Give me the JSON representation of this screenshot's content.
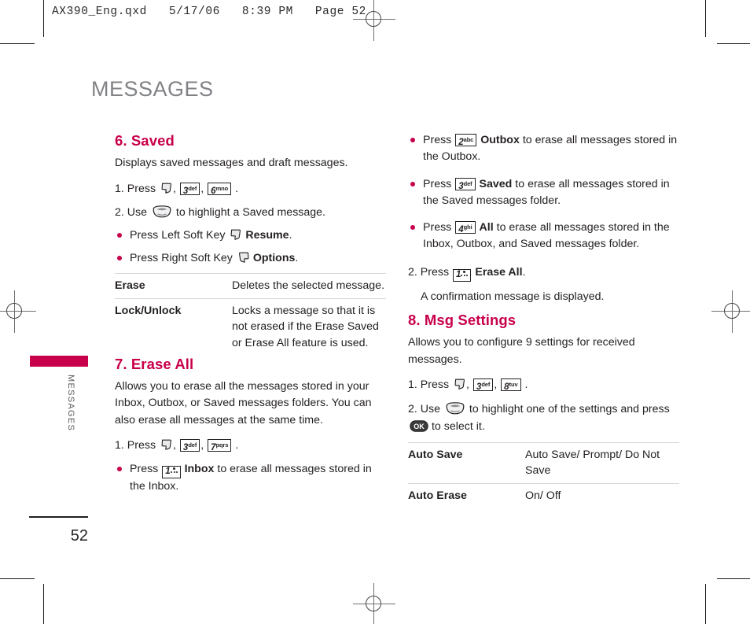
{
  "print_marks": {
    "slug": "AX390_Eng.qxd   5/17/06   8:39 PM   Page 52"
  },
  "side": {
    "tab_label": "MESSAGES",
    "page_number": "52"
  },
  "chapter": {
    "title": "MESSAGES"
  },
  "colors": {
    "accent": "#c8004b",
    "chapter_title": "#808285",
    "body_text": "#231f20",
    "rule": "#d7d8da"
  },
  "icons": {
    "left_soft_key": "left-soft-key-icon",
    "right_soft_key": "right-soft-key-icon",
    "nav_key": "navigation-key-icon",
    "ok_key": "ok-key-icon",
    "key_1": "key-1-voicemail",
    "key_2": "key-2-abc",
    "key_3": "key-3-def",
    "key_4": "key-4-ghi",
    "key_6": "key-6-mno",
    "key_7": "key-7-pqrs",
    "key_8": "key-8-tuv",
    "ok_label": "OK"
  },
  "keycaps": {
    "k1": {
      "digit": "1",
      "letters": ""
    },
    "k2": {
      "digit": "2",
      "letters": "abc"
    },
    "k3": {
      "digit": "3",
      "letters": "def"
    },
    "k4": {
      "digit": "4",
      "letters": "ghi"
    },
    "k6": {
      "digit": "6",
      "letters": "mno"
    },
    "k7": {
      "digit": "7",
      "letters": "pqrs"
    },
    "k8": {
      "digit": "8",
      "letters": "tuv"
    }
  },
  "left_column": {
    "section_saved": {
      "heading": "6. Saved",
      "intro": "Displays saved messages and draft messages.",
      "step1_prefix": "1. Press",
      "step1_sep": ",",
      "step1_end": ".",
      "step2_prefix": "2. Use",
      "step2_suffix": "to highlight a Saved message.",
      "bullets": [
        {
          "pre": "Press Left Soft Key",
          "bold": "Resume",
          "post": "."
        },
        {
          "pre": "Press Right Soft Key",
          "bold": "Options",
          "post": "."
        }
      ],
      "table": [
        {
          "term": "Erase",
          "desc": "Deletes the selected message."
        },
        {
          "term": "Lock/Unlock",
          "desc": "Locks a message so that it is not erased if the Erase Saved or Erase All feature is used."
        }
      ]
    },
    "section_erase_all": {
      "heading": "7. Erase All",
      "intro": "Allows you to erase all the messages stored in your Inbox, Outbox, or Saved messages folders. You can also erase all messages at the same time.",
      "step1_prefix": "1. Press",
      "step1_sep": ",",
      "step1_end": ".",
      "bullets": [
        {
          "pre": "Press",
          "bold": "Inbox",
          "post": "to erase all messages stored in the Inbox."
        }
      ]
    }
  },
  "right_column": {
    "erase_all_continued": {
      "bullets": [
        {
          "pre": "Press",
          "bold": "Outbox",
          "post": "to erase all messages stored in the Outbox."
        },
        {
          "pre": "Press",
          "bold": "Saved",
          "post": "to erase all messages stored in the Saved messages folder."
        },
        {
          "pre": "Press",
          "bold": "All",
          "post": "to erase all messages stored in the Inbox, Outbox, and Saved messages folder."
        }
      ],
      "step2_prefix": "2. Press",
      "step2_bold": "Erase All",
      "step2_end": ".",
      "note": "A confirmation message is displayed."
    },
    "section_msg_settings": {
      "heading": "8. Msg Settings",
      "intro": "Allows you to configure 9 settings for received messages.",
      "step1_prefix": "1. Press",
      "step1_sep": ",",
      "step1_end": ".",
      "step2_prefix": "2. Use",
      "step2_mid": "to highlight one of the settings and press",
      "step2_suffix": "to select it.",
      "table": [
        {
          "term": "Auto Save",
          "desc": "Auto Save/ Prompt/ Do Not Save"
        },
        {
          "term": "Auto Erase",
          "desc": "On/ Off"
        }
      ]
    }
  }
}
